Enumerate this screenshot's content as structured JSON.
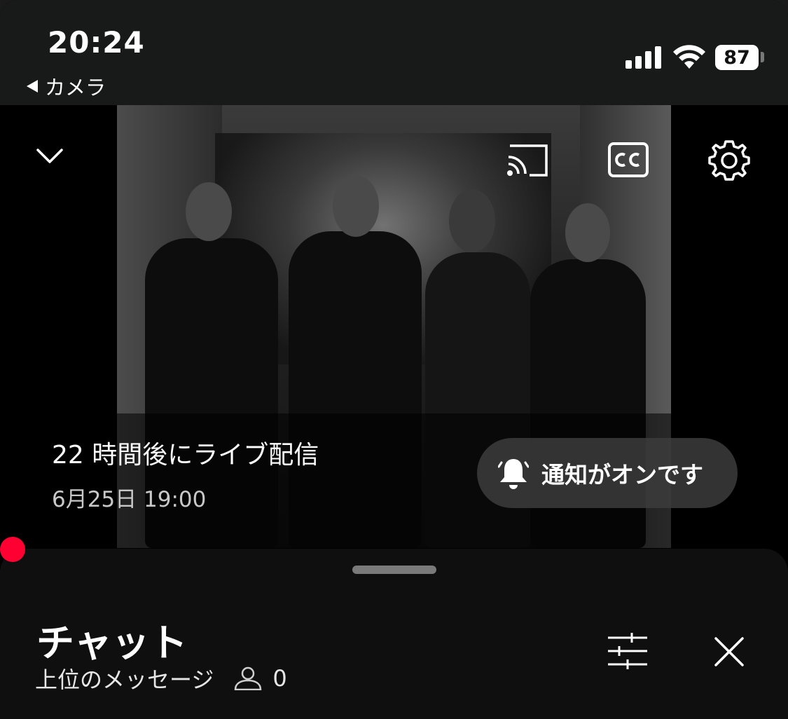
{
  "status_bar": {
    "time": "20:24",
    "back_label": "カメラ",
    "battery_level": "87",
    "signal_bars": 4,
    "wifi_level": 3
  },
  "player": {
    "icons": {
      "collapse": "chevron-down-icon",
      "cast": "cast-icon",
      "captions": "cc-icon",
      "settings": "gear-icon"
    },
    "live_title": "22 時間後にライブ配信",
    "live_date": "6月25日 19:00",
    "notify_label": "通知がオンです",
    "accent_color": "#ff0033"
  },
  "chat": {
    "title": "チャット",
    "subtitle": "上位のメッセージ",
    "viewer_count": "0",
    "icons": {
      "viewers": "person-icon",
      "filter": "sliders-icon",
      "close": "close-icon"
    }
  }
}
